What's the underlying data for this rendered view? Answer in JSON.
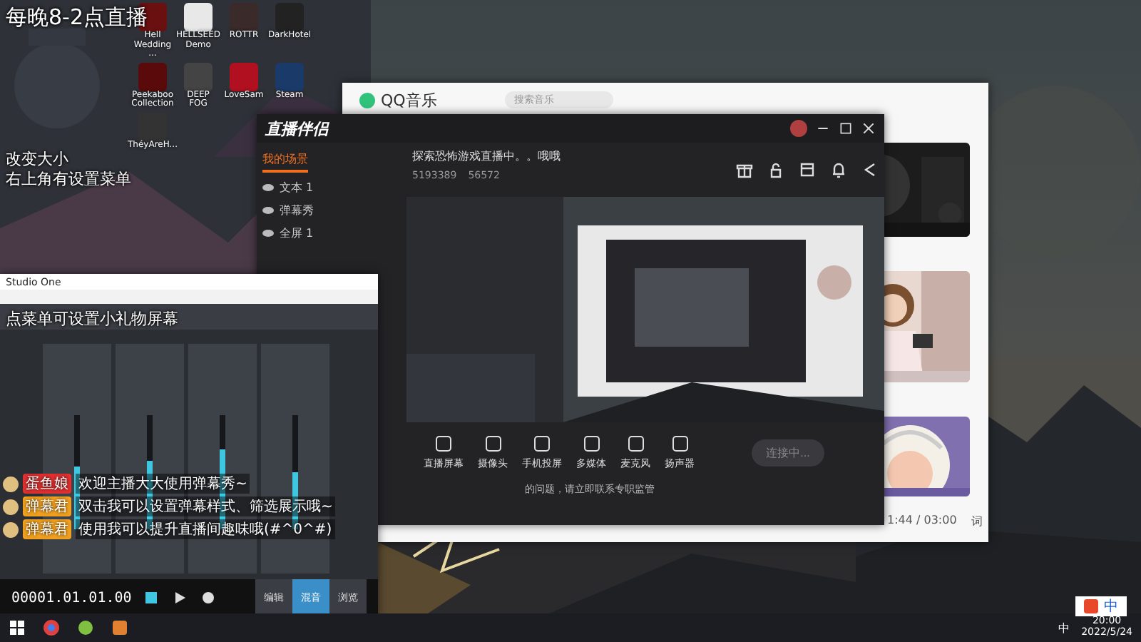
{
  "overlay_texts": [
    "每晚8-2点直播",
    "改变大小",
    "右上角有设置菜单",
    "点菜单可设置小礼物屏幕"
  ],
  "desktop_icons": [
    {
      "label": "Hell Wedding ..."
    },
    {
      "label": "HELLSEED Demo"
    },
    {
      "label": "ROTTR"
    },
    {
      "label": "DarkHotel"
    },
    {
      "label": "Peekaboo Collection"
    },
    {
      "label": "DEEP FOG"
    },
    {
      "label": "LoveSam"
    },
    {
      "label": "Steam"
    },
    {
      "label": "ThéyAreH..."
    }
  ],
  "studio_one": {
    "title": "Studio One",
    "channels": [
      {
        "level": 0.55
      },
      {
        "level": 0.6
      },
      {
        "level": 0.7
      },
      {
        "level": 0.5
      }
    ],
    "time": "00001.01.01.00",
    "views": [
      {
        "label": "编辑",
        "selected": false
      },
      {
        "label": "混音",
        "selected": true
      },
      {
        "label": "浏览",
        "selected": false
      }
    ]
  },
  "danmaku": [
    {
      "name": "蛋鱼娘",
      "color": "#e03030",
      "text": "欢迎主播大大使用弹幕秀~"
    },
    {
      "name": "弹幕君",
      "color": "#f0a020",
      "text": "双击我可以设置弹幕样式、筛选展示哦~"
    },
    {
      "name": "弹幕君",
      "color": "#f0a020",
      "text": "使用我可以提升直播间趣味哦(#^0^#)"
    }
  ],
  "qq_music": {
    "title": "QQ音乐",
    "search": {
      "placeholder": "搜索音乐"
    },
    "progress": "1:44 / 03:00",
    "lyrics": "词"
  },
  "live_companion": {
    "title": "直播伴侣",
    "tabs": [
      {
        "label": "我的场景",
        "selected": true
      }
    ],
    "sources": [
      {
        "label": "文本 1"
      },
      {
        "label": "弹幕秀"
      },
      {
        "label": "全屏 1"
      }
    ],
    "stream_title": "探索恐怖游戏直播中。。哦哦",
    "fans": "5193389",
    "heat": "56572",
    "tools": [
      {
        "label": "直播屏幕"
      },
      {
        "label": "摄像头"
      },
      {
        "label": "手机投屏"
      },
      {
        "label": "多媒体"
      },
      {
        "label": "麦克风"
      },
      {
        "label": "扬声器"
      }
    ],
    "start_button": "连接中...",
    "notice": "的问题，请立即联系专职监管"
  },
  "taskbar": {
    "ime": "中",
    "time": "20:00",
    "date": "2022/5/24"
  },
  "ime_bar": {
    "mode": "中"
  }
}
